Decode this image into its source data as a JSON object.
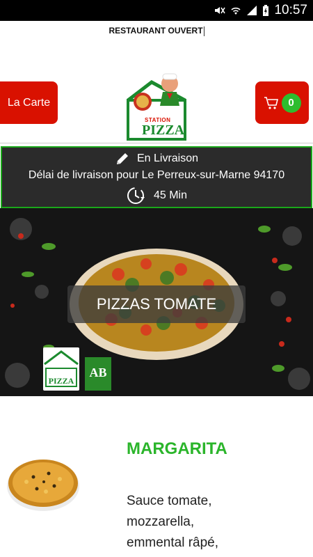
{
  "status_bar": {
    "time": "10:57"
  },
  "header": {
    "open_status": "RESTAURANT OUVERT",
    "menu_button_label": "La Carte",
    "cart_count": "0",
    "logo_text_top": "STATION",
    "logo_text_main": "PIZZA"
  },
  "delivery": {
    "mode": "En Livraison",
    "delay_text": "Délai de livraison pour Le Perreux-sur-Marne 94170",
    "duration": "45 Min"
  },
  "category": {
    "title": "PIZZAS TOMATE",
    "badge_text": "AB"
  },
  "product": {
    "name": "MARGARITA",
    "description": "Sauce tomate, mozzarella, emmental râpé,"
  },
  "colors": {
    "brand_red": "#d91100",
    "brand_green": "#2bb52b",
    "dark_panel": "#2b2b2b"
  }
}
